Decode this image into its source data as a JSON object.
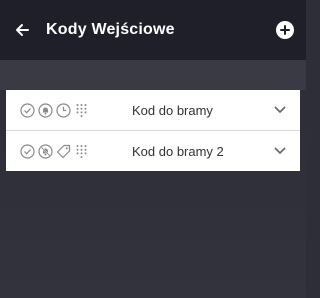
{
  "header": {
    "title": "Kody Wejściowe",
    "back_icon": "arrow-left-icon",
    "add_icon": "plus-circle-icon"
  },
  "codes": [
    {
      "label": "Kod do bramy",
      "icons": [
        "check-circle-icon",
        "bell-icon",
        "clock-icon",
        "keypad-icon"
      ]
    },
    {
      "label": "Kod do bramy 2",
      "icons": [
        "check-circle-icon",
        "bell-off-icon",
        "tag-icon",
        "keypad-icon"
      ]
    }
  ],
  "colors": {
    "header_bg": "#1f1f29",
    "page_bg": "#2e2e38",
    "icon_gray": "#8a8a8a",
    "text": "#333333"
  }
}
